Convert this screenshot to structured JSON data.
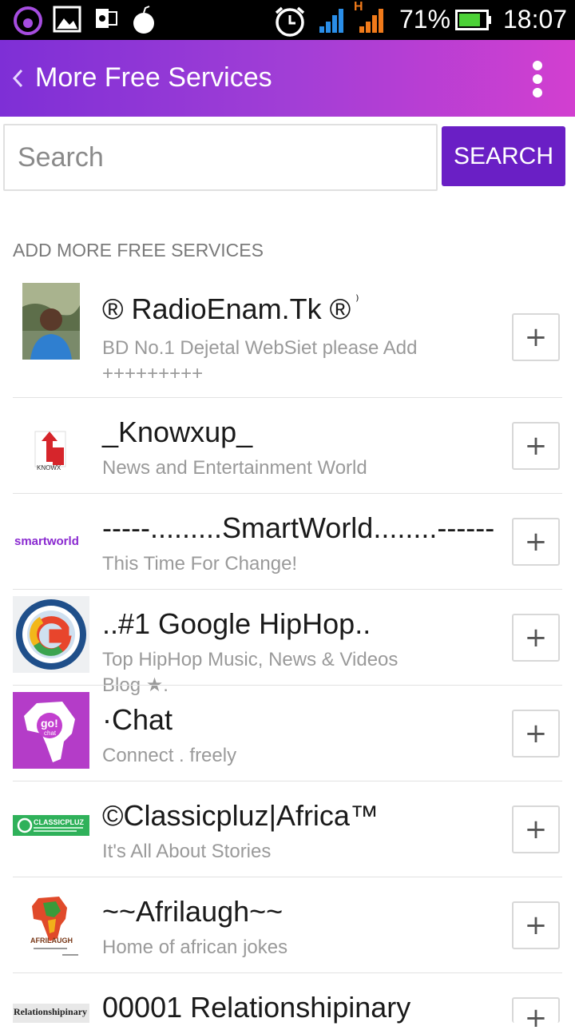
{
  "status_bar": {
    "battery": "71%",
    "time": "18:07",
    "network_type": "H",
    "icons": [
      "hotspot-icon",
      "gallery-icon",
      "outlook-icon",
      "bomb-icon",
      "alarm-icon",
      "wifi-signal-icon",
      "cell-signal-icon",
      "battery-icon"
    ]
  },
  "app_bar": {
    "title": "More Free Services"
  },
  "search": {
    "placeholder": "Search",
    "button_label": "SEARCH"
  },
  "section_header": "ADD MORE FREE SERVICES",
  "services": [
    {
      "title": "® RadioEnam.Tk ®",
      "title_suffix": "⁾",
      "subtitle": "BD No.1 Dejetal WebSiet please Add +++++++++",
      "add_label": "+"
    },
    {
      "title": "_Knowxup_",
      "subtitle": "News and Entertainment World",
      "add_label": "+"
    },
    {
      "title": "-----.........SmartWorld........------",
      "subtitle": "This Time For Change!",
      "add_label": "+"
    },
    {
      "title": "..#1 Google HipHop..",
      "subtitle": "Top HipHop Music, News & Videos Blog ★.",
      "add_label": "+"
    },
    {
      "title": "·Chat",
      "subtitle": "Connect . freely",
      "add_label": "+"
    },
    {
      "title": "©Classicpluz|Africa™",
      "subtitle": "It's All About Stories",
      "add_label": "+"
    },
    {
      "title": "~~Afrilaugh~~",
      "subtitle": "Home of african jokes",
      "add_label": "+"
    },
    {
      "title": "00001 Relationshipinary",
      "subtitle": "",
      "add_label": "+"
    }
  ],
  "logo_text": {
    "knowxup": "KNOWX",
    "smartworld": "smartworld",
    "gochat": "go!",
    "gochat_sub": "chat",
    "classicpluz": "CLASSICPLUZ",
    "afrilaugh": "AFRILAUGH",
    "relationshipinary": "Relationshipinary"
  },
  "colors": {
    "app_bar_start": "#7e2fd6",
    "app_bar_end": "#d23fd0",
    "search_button": "#6a1fc5"
  }
}
